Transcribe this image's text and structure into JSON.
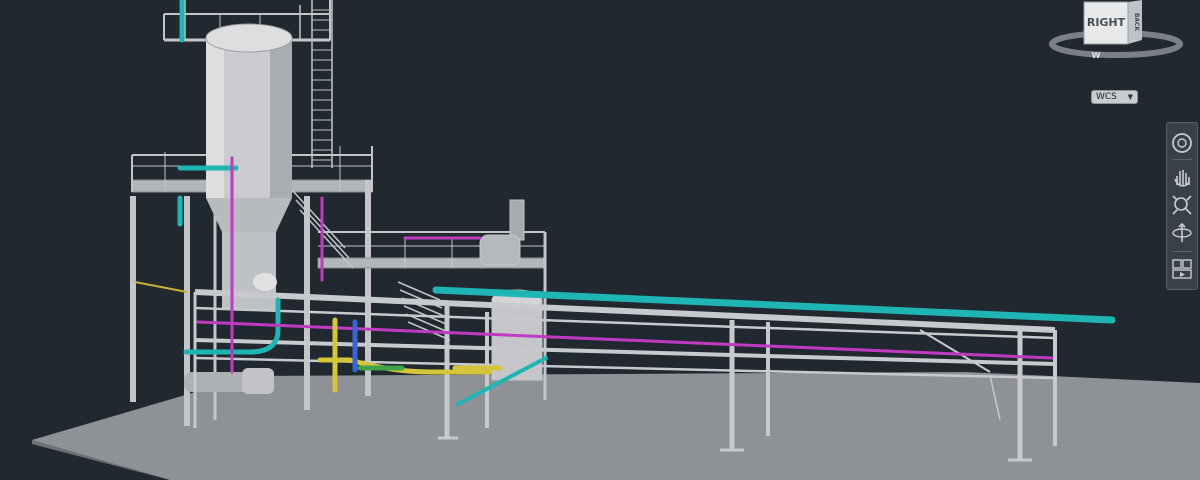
{
  "viewport": {
    "background": "#212830",
    "floor_color": "#8f9398",
    "steel_color": "#b6b8bb",
    "pipe_colors": {
      "cyan": "#1fb5b5",
      "magenta": "#c23ac2",
      "yellow": "#d6c43a",
      "blue": "#3a63d6",
      "green": "#3fa34a"
    }
  },
  "viewcube": {
    "face_label": "RIGHT",
    "side_label": "BACK",
    "compass_label": "W"
  },
  "ucs_menu": {
    "label": "WCS"
  },
  "navigation_bar": {
    "tools": [
      "full-navigation-wheel-icon",
      "pan-icon",
      "zoom-extents-icon",
      "orbit-icon",
      "showmotion-icon"
    ]
  }
}
